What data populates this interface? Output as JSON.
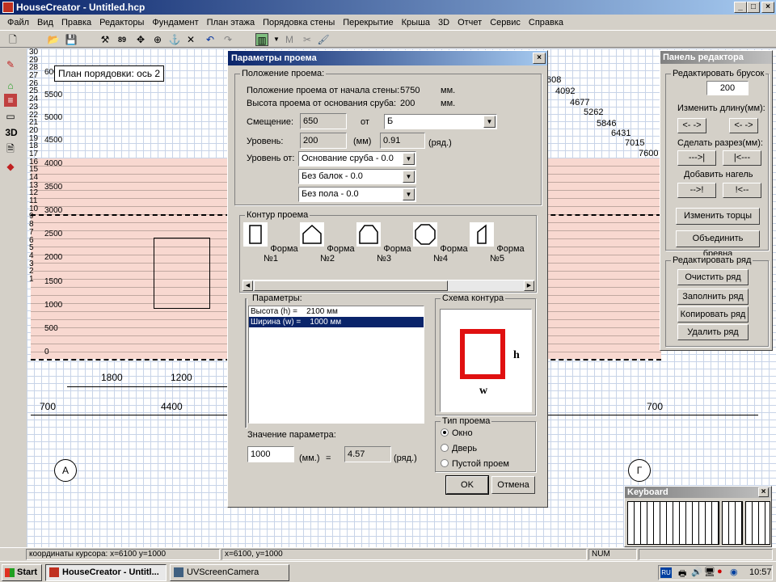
{
  "window": {
    "title": "HouseCreator - Untitled.hcp"
  },
  "menu": [
    "Файл",
    "Вид",
    "Правка",
    "Редакторы",
    "Фундамент",
    "План этажа",
    "Порядовка стены",
    "Перекрытие",
    "Крыша",
    "3D",
    "Отчет",
    "Сервис",
    "Справка"
  ],
  "left_toolbar": {
    "label_3d": "3D"
  },
  "canvas": {
    "tooltip": "План порядовки: ось 2",
    "ruler_rows": [
      "30",
      "29",
      "28",
      "27",
      "26",
      "25",
      "24",
      "23",
      "22",
      "21",
      "20",
      "19",
      "18",
      "17",
      "16",
      "15",
      "14",
      "13",
      "12",
      "11",
      "10",
      "9",
      "8",
      "7",
      "6",
      "5",
      "4",
      "3",
      "2",
      "1"
    ],
    "ruler_mm": [
      "6000",
      "5500",
      "5000",
      "4500",
      "4000",
      "3500",
      "3000",
      "2500",
      "2000",
      "1500",
      "1000",
      "500",
      "0"
    ],
    "right_dims": [
      "608",
      "4092",
      "4677",
      "5262",
      "5846",
      "6431",
      "7015",
      "7600"
    ],
    "dims_bottom_1": [
      "1800",
      "1200"
    ],
    "dims_bottom_2": [
      "700",
      "4400",
      "700"
    ],
    "axis_a": "А",
    "axis_g": "Г"
  },
  "dialog": {
    "title": "Параметры проема",
    "position_group": "Положение проема:",
    "pos_from_start_label": "Положение проема от начала стены:",
    "pos_from_start_value": "5750",
    "pos_from_start_unit": "мм.",
    "height_from_base_label": "Высота проема от  основания сруба:",
    "height_from_base_value": "200",
    "height_from_base_unit": "мм.",
    "offset_label": "Смещение:",
    "offset_value": "650",
    "offset_from": "от",
    "offset_ref": "Б",
    "level_label": "Уровень:",
    "level_value": "200",
    "level_unit": "(мм)",
    "level_rows": "0.91",
    "level_rows_unit": "(ряд.)",
    "level_from_label": "Уровень от:",
    "level_from_1": "Основание сруба - 0.0",
    "level_from_2": "Без балок - 0.0",
    "level_from_3": "Без пола - 0.0",
    "contour_group": "Контур проема",
    "shapes": [
      "Форма №1",
      "Форма №2",
      "Форма №3",
      "Форма №4",
      "Форма №5"
    ],
    "params_group": "Параметры:",
    "params": [
      {
        "name": "Высота (h) =",
        "value": "2100 мм"
      },
      {
        "name": "Ширина (w) =",
        "value": "1000 мм"
      }
    ],
    "scheme_group": "Схема контура",
    "scheme_h": "h",
    "scheme_w": "w",
    "param_value_label": "Значение параметра:",
    "param_value": "1000",
    "param_value_unit": "(мм.)",
    "equals": "=",
    "param_rows": "4.57",
    "param_rows_unit": "(ряд.)",
    "type_group": "Тип проема",
    "types": [
      "Окно",
      "Дверь",
      "Пустой проем"
    ],
    "ok": "OK",
    "cancel": "Отмена"
  },
  "editor_panel": {
    "title": "Панель редактора",
    "edit_log_group": "Редактировать брусок",
    "log_value": "200",
    "change_length": "Изменить длину(мм):",
    "arrows_a": "<- ->",
    "arrows_b": "<- ->",
    "make_cut": "Сделать разрез(мм):",
    "cut_a": "--->|",
    "cut_b": "|<---",
    "add_pin": "Добавить нагель",
    "pin_a": "-->!",
    "pin_b": "!<--",
    "change_ends": "Изменить торцы",
    "merge_logs": "Объединить бревна",
    "edit_row_group": "Редактировать ряд",
    "clear_row": "Очистить ряд",
    "fill_row": "Заполнить ряд",
    "copy_row": "Копировать ряд",
    "delete_row": "Удалить ряд"
  },
  "keyboard": {
    "title": "Keyboard"
  },
  "status": {
    "cursor": "координаты курсора: x=6100 y=1000",
    "xy": "x=6100, y=1000",
    "num": "NUM"
  },
  "taskbar": {
    "start": "Start",
    "task1": "HouseCreator - Untitl...",
    "task2": "UVScreenCamera",
    "lang": "RU",
    "clock": "10:57"
  }
}
